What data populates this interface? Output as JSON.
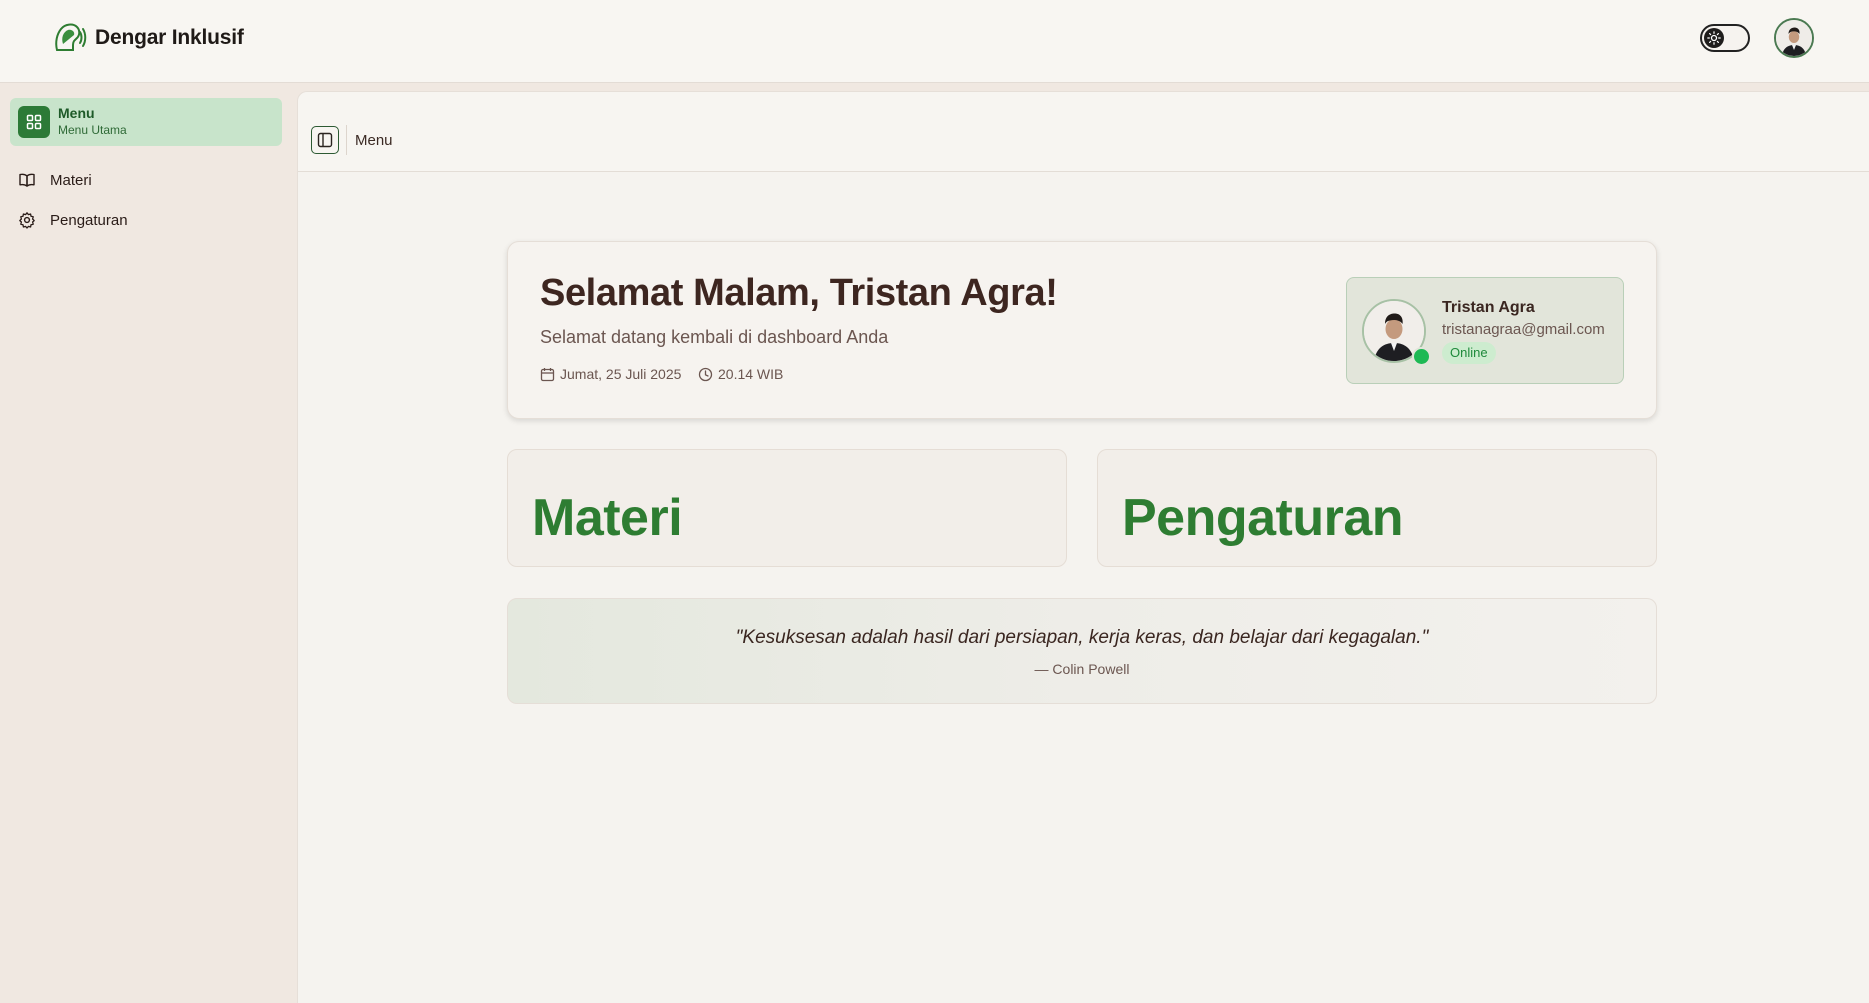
{
  "app": {
    "name": "Dengar Inklusif"
  },
  "sidebar": {
    "active": {
      "title": "Menu",
      "subtitle": "Menu Utama",
      "icon": "grid-icon"
    },
    "items": [
      {
        "label": "Materi",
        "icon": "book-icon"
      },
      {
        "label": "Pengaturan",
        "icon": "gear-icon"
      }
    ]
  },
  "main_header": {
    "label": "Menu"
  },
  "welcome": {
    "title": "Selamat Malam, Tristan Agra!",
    "subtitle": "Selamat datang kembali di dashboard Anda",
    "date": "Jumat, 25 Juli 2025",
    "time": "20.14 WIB"
  },
  "profile": {
    "name": "Tristan Agra",
    "email": "tristanagraa@gmail.com",
    "status": "Online"
  },
  "cards": [
    {
      "title": "Materi"
    },
    {
      "title": "Pengaturan"
    }
  ],
  "quote": {
    "text": "\"Kesuksesan adalah hasil dari persiapan, kerja keras, dan belajar dari kegagalan.\"",
    "author": "— Colin Powell"
  },
  "colors": {
    "accent": "#2e7d32",
    "active_bg": "#c8e4cb",
    "online": "#1db954",
    "heading": "#3d2620"
  }
}
